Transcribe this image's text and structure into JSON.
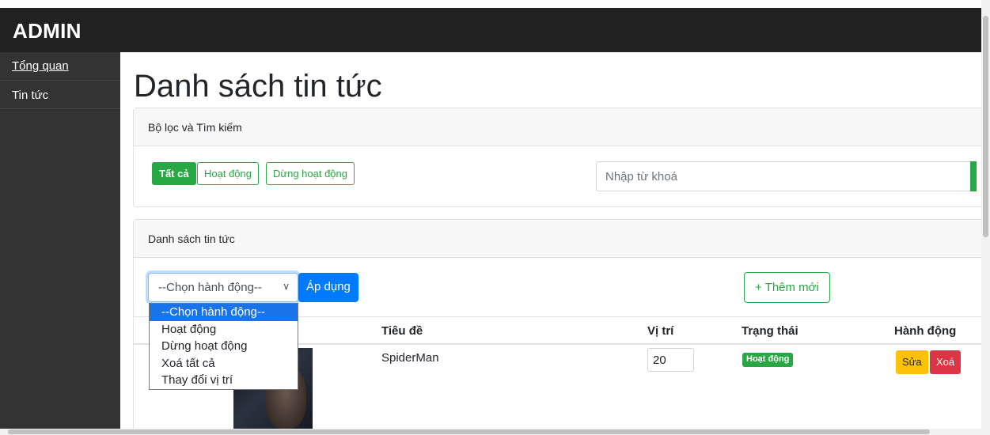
{
  "header": {
    "brand": "ADMIN"
  },
  "sidebar": {
    "items": [
      {
        "label": "Tổng quan"
      },
      {
        "label": "Tin tức"
      }
    ]
  },
  "main": {
    "title": "Danh sách tin tức",
    "filter_card": {
      "header": "Bộ lọc và Tìm kiếm",
      "buttons": [
        {
          "label": "Tất cả",
          "active": true
        },
        {
          "label": "Hoạt động",
          "active": false
        },
        {
          "label": "Dừng hoạt động",
          "active": false
        }
      ],
      "search": {
        "placeholder": "Nhập từ khoá",
        "value": ""
      }
    },
    "list_card": {
      "header": "Danh sách tin tức",
      "action_select": {
        "value": "--Chọn hành động--",
        "options": [
          "--Chọn hành động--",
          "Hoạt động",
          "Dừng hoạt động",
          "Xoá tất cả",
          "Thay đổi vị trí"
        ]
      },
      "apply_label": "Áp dụng",
      "add_label": "+ Thêm mới",
      "table": {
        "columns": {
          "title": "Tiêu đề",
          "position": "Vị trí",
          "status": "Trạng thái",
          "actions": "Hành động"
        },
        "rows": [
          {
            "title": "SpiderMan",
            "position": "20",
            "status": "Hoạt động",
            "edit_label": "Sửa",
            "delete_label": "Xoá"
          }
        ]
      }
    }
  },
  "colors": {
    "header_bg": "#212121",
    "sidebar_bg": "#333333",
    "success": "#28a745",
    "primary": "#007bff",
    "warning": "#ffc107",
    "danger": "#dc3545"
  }
}
